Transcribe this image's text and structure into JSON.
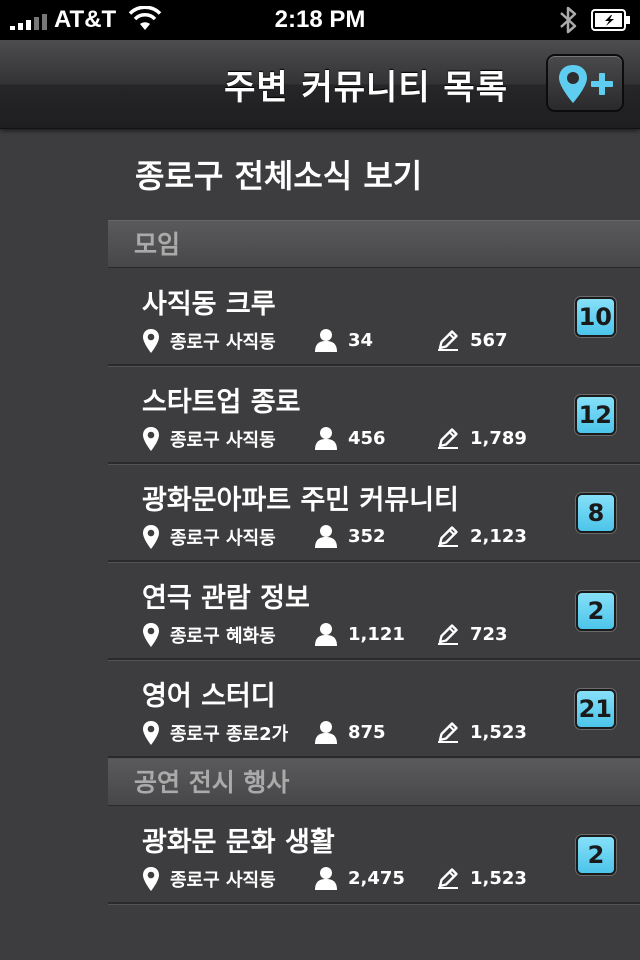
{
  "status_bar": {
    "carrier": "AT&T",
    "time": "2:18 PM"
  },
  "nav": {
    "title": "주변 커뮤니티 목록",
    "add_button_icon": "location-pin-plus-icon"
  },
  "header": {
    "title": "종로구 전체소식 보기"
  },
  "colors": {
    "accent": "#5fcdf0",
    "background": "#3d3d3f"
  },
  "sections": [
    {
      "title": "모임",
      "items": [
        {
          "name": "사직동 크루",
          "location": "종로구 사직동",
          "members": "34",
          "posts": "567",
          "badge": "10"
        },
        {
          "name": "스타트업 종로",
          "location": "종로구 사직동",
          "members": "456",
          "posts": "1,789",
          "badge": "12"
        },
        {
          "name": "광화문아파트 주민 커뮤니티",
          "location": "종로구 사직동",
          "members": "352",
          "posts": "2,123",
          "badge": "8"
        },
        {
          "name": "연극 관람 정보",
          "location": "종로구 혜화동",
          "members": "1,121",
          "posts": "723",
          "badge": "2"
        },
        {
          "name": "영어 스터디",
          "location": "종로구 종로2가",
          "members": "875",
          "posts": "1,523",
          "badge": "21"
        }
      ]
    },
    {
      "title": "공연 전시 행사",
      "items": [
        {
          "name": "광화문 문화 생활",
          "location": "종로구 사직동",
          "members": "2,475",
          "posts": "1,523",
          "badge": "2"
        }
      ]
    }
  ]
}
